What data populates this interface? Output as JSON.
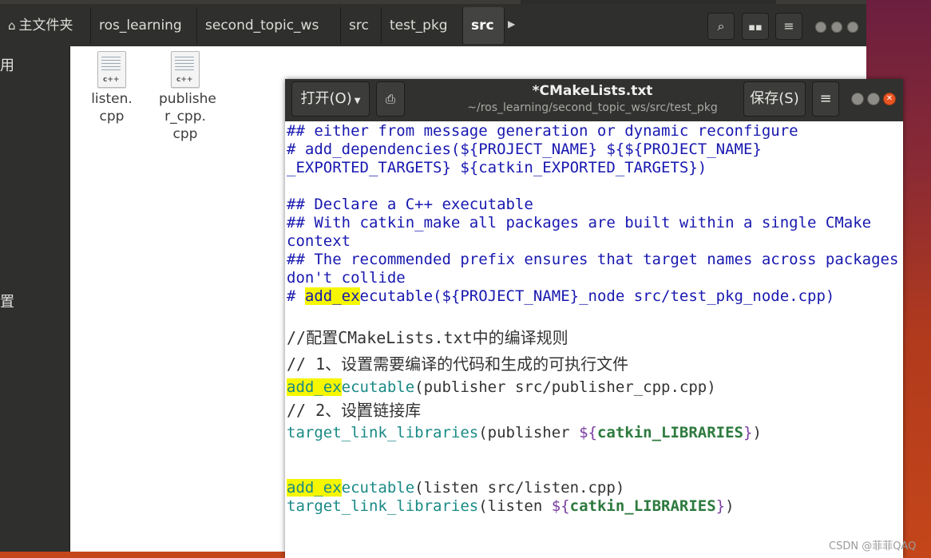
{
  "nautilus": {
    "breadcrumbs": [
      "主文件夹",
      "ros_learning",
      "second_topic_ws",
      "src",
      "test_pkg",
      "src"
    ],
    "sidebar_partial": [
      "用",
      "置"
    ],
    "files": [
      {
        "name_lines": [
          "listen.",
          "cpp"
        ],
        "badge": "c++"
      },
      {
        "name_lines": [
          "publishe",
          "r_cpp.",
          "cpp"
        ],
        "badge": "c++"
      }
    ]
  },
  "gedit": {
    "open_label": "打开(O)",
    "title": "*CMakeLists.txt",
    "subtitle": "~/ros_learning/second_topic_ws/src/test_pkg",
    "save_label": "保存(S)",
    "code": {
      "l1": "## either from message generation or dynamic reconfigure",
      "l2": "# add_dependencies(${PROJECT_NAME} ${${PROJECT_NAME}",
      "l3": "_EXPORTED_TARGETS} ${catkin_EXPORTED_TARGETS})",
      "l5": "## Declare a C++ executable",
      "l6": "## With catkin_make all packages are built within a single CMake",
      "l7": "context",
      "l8": "## The recommended prefix ensures that target names across packages",
      "l9": "don't collide",
      "l10_pre": "# ",
      "l10_hl": "add_ex",
      "l10_post": "ecutable(${PROJECT_NAME}_node src/test_pkg_node.cpp)",
      "c1": "//配置CMakeLists.txt中的编译规则",
      "c2": "// 1、设置需要编译的代码和生成的可执行文件",
      "l13_hl": "add_ex",
      "l13_kw": "ecutable",
      "l13_rest": "(publisher src/publisher_cpp.cpp)",
      "c3": "// 2、设置链接库",
      "l15_kw": "target_link_libraries",
      "l15_mid": "(publisher ",
      "l15_open": "${",
      "l15_var": "catkin_LIBRARIES",
      "l15_close": "}",
      "l15_end": ")",
      "l18_hl": "add_ex",
      "l18_kw": "ecutable",
      "l18_rest": "(listen src/listen.cpp)",
      "l19_kw": "target_link_libraries",
      "l19_mid": "(listen ",
      "l19_open": "${",
      "l19_var": "catkin_LIBRARIES",
      "l19_close": "}",
      "l19_end": ")"
    }
  },
  "watermark": "CSDN @菲菲QAQ"
}
